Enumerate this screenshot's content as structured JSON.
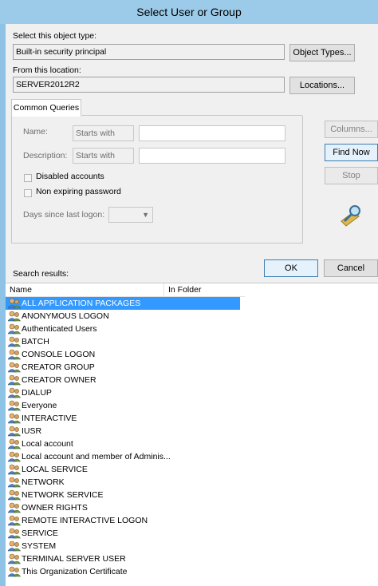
{
  "window": {
    "title": "Select User or Group"
  },
  "object_type": {
    "label": "Select this object type:",
    "value": "Built-in security principal",
    "button": "Object Types..."
  },
  "location": {
    "label": "From this location:",
    "value": "SERVER2012R2",
    "button": "Locations..."
  },
  "queries": {
    "tab": "Common Queries",
    "name_label": "Name:",
    "name_mode": "Starts with",
    "desc_label": "Description:",
    "desc_mode": "Starts with",
    "disabled_label": "Disabled accounts",
    "nonexpiring_label": "Non expiring password",
    "days_label": "Days since last logon:"
  },
  "buttons": {
    "columns": "Columns...",
    "find_now": "Find Now",
    "stop": "Stop",
    "ok": "OK",
    "cancel": "Cancel"
  },
  "results": {
    "label": "Search results:",
    "columns": [
      "Name",
      "In Folder"
    ],
    "selected_index": 0,
    "rows": [
      "ALL APPLICATION PACKAGES",
      "ANONYMOUS LOGON",
      "Authenticated Users",
      "BATCH",
      "CONSOLE LOGON",
      "CREATOR GROUP",
      "CREATOR OWNER",
      "DIALUP",
      "Everyone",
      "INTERACTIVE",
      "IUSR",
      "Local account",
      "Local account and member of Adminis...",
      "LOCAL SERVICE",
      "NETWORK",
      "NETWORK SERVICE",
      "OWNER RIGHTS",
      "REMOTE INTERACTIVE LOGON",
      "SERVICE",
      "SYSTEM",
      "TERMINAL SERVER USER",
      "This Organization Certificate"
    ]
  },
  "colors": {
    "accent": "#3399ff",
    "titlebar": "#9ccbe9"
  }
}
